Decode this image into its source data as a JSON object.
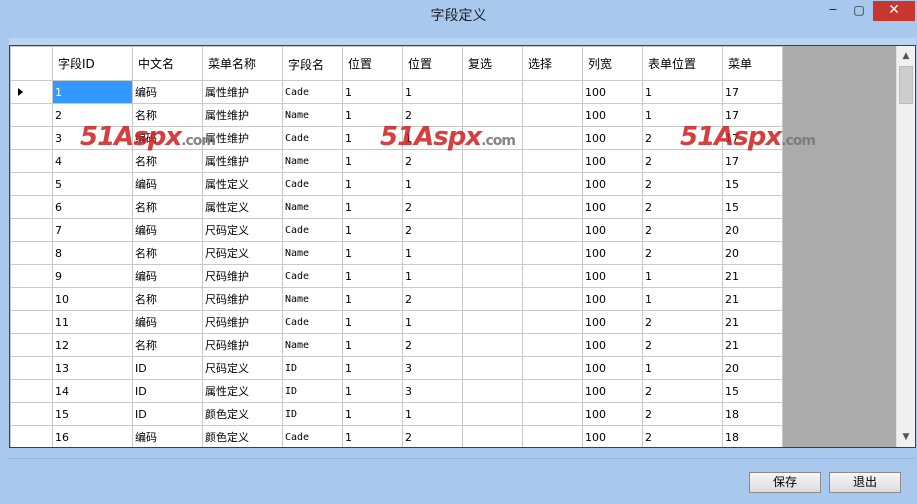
{
  "window": {
    "title": "字段定义",
    "minimize_glyph": "‒",
    "maximize_glyph": "▢",
    "close_glyph": "✕"
  },
  "grid": {
    "columns": [
      "字段ID",
      "中文名",
      "菜单名称",
      "字段名",
      "位置",
      "位置",
      "复选",
      "选择",
      "列宽",
      "表单位置",
      "菜单"
    ],
    "rows": [
      [
        "1",
        "编码",
        "属性维护",
        "Cade",
        "1",
        "1",
        "",
        "",
        "100",
        "1",
        "17"
      ],
      [
        "2",
        "名称",
        "属性维护",
        "Name",
        "1",
        "2",
        "",
        "",
        "100",
        "1",
        "17"
      ],
      [
        "3",
        "编码",
        "属性维护",
        "Cade",
        "1",
        "1",
        "",
        "",
        "100",
        "2",
        "17"
      ],
      [
        "4",
        "名称",
        "属性维护",
        "Name",
        "1",
        "2",
        "",
        "",
        "100",
        "2",
        "17"
      ],
      [
        "5",
        "编码",
        "属性定义",
        "Cade",
        "1",
        "1",
        "",
        "",
        "100",
        "2",
        "15"
      ],
      [
        "6",
        "名称",
        "属性定义",
        "Name",
        "1",
        "2",
        "",
        "",
        "100",
        "2",
        "15"
      ],
      [
        "7",
        "编码",
        "尺码定义",
        "Cade",
        "1",
        "2",
        "",
        "",
        "100",
        "2",
        "20"
      ],
      [
        "8",
        "名称",
        "尺码定义",
        "Name",
        "1",
        "1",
        "",
        "",
        "100",
        "2",
        "20"
      ],
      [
        "9",
        "编码",
        "尺码维护",
        "Cade",
        "1",
        "1",
        "",
        "",
        "100",
        "1",
        "21"
      ],
      [
        "10",
        "名称",
        "尺码维护",
        "Name",
        "1",
        "2",
        "",
        "",
        "100",
        "1",
        "21"
      ],
      [
        "11",
        "编码",
        "尺码维护",
        "Cade",
        "1",
        "1",
        "",
        "",
        "100",
        "2",
        "21"
      ],
      [
        "12",
        "名称",
        "尺码维护",
        "Name",
        "1",
        "2",
        "",
        "",
        "100",
        "2",
        "21"
      ],
      [
        "13",
        "ID",
        "尺码定义",
        "ID",
        "1",
        "3",
        "",
        "",
        "100",
        "1",
        "20"
      ],
      [
        "14",
        "ID",
        "属性定义",
        "ID",
        "1",
        "3",
        "",
        "",
        "100",
        "2",
        "15"
      ],
      [
        "15",
        "ID",
        "颜色定义",
        "ID",
        "1",
        "1",
        "",
        "",
        "100",
        "2",
        "18"
      ],
      [
        "16",
        "编码",
        "颜色定义",
        "Cade",
        "1",
        "2",
        "",
        "",
        "100",
        "2",
        "18"
      ]
    ],
    "selected_row": 0,
    "scroll_up_glyph": "▲",
    "scroll_down_glyph": "▼"
  },
  "watermark": {
    "brand": "51Aspx",
    "suffix": ".com",
    "color": "#cd1e1e"
  },
  "buttons": {
    "save_label": "保存",
    "exit_label": "退出"
  },
  "colors": {
    "frame": "#a8c8ee",
    "selection": "#3399ff",
    "close_button": "#c7372f"
  }
}
